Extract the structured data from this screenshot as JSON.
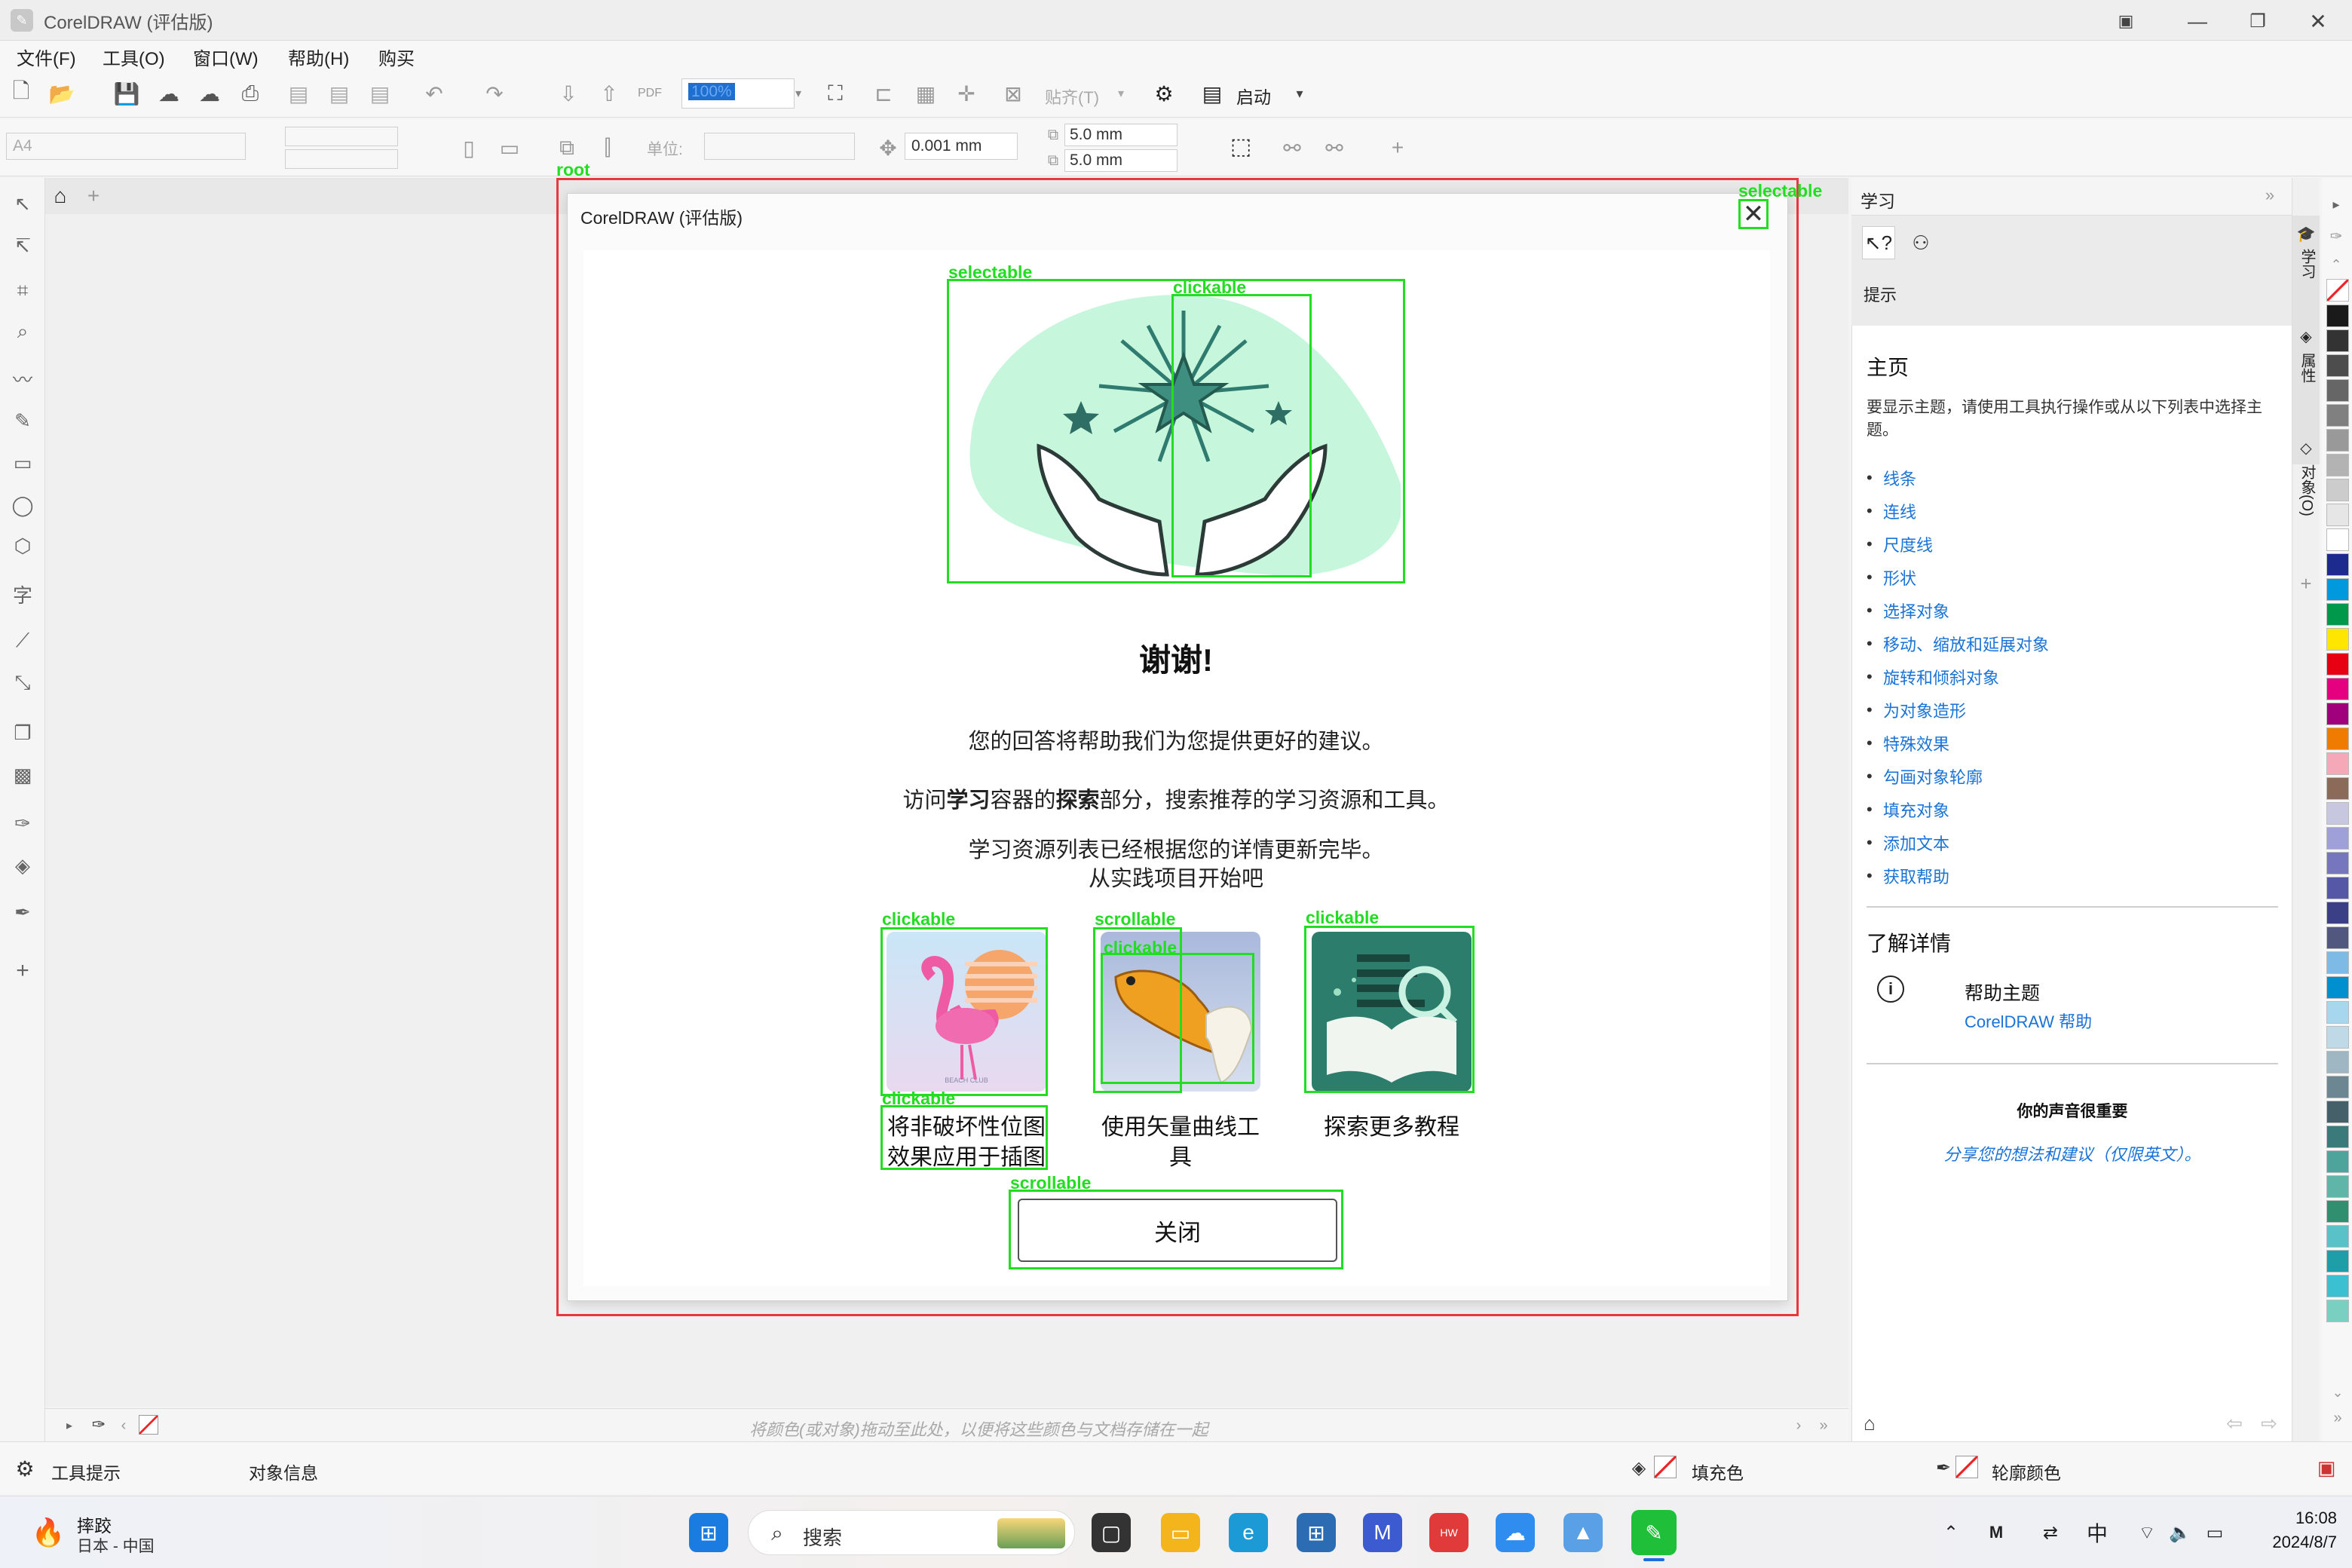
{
  "window": {
    "title": "CorelDRAW (评估版)"
  },
  "menu": [
    {
      "label": "文件(F)"
    },
    {
      "label": "工具(O)"
    },
    {
      "label": "窗口(W)"
    },
    {
      "label": "帮助(H)"
    },
    {
      "label": "购买"
    }
  ],
  "toolbar": {
    "zoom_value": "100%",
    "snap_label": "贴齐(T)",
    "launch_label": "启动"
  },
  "propertybar": {
    "page_size": "A4",
    "units_label": "单位:",
    "nudge": "0.001 mm",
    "dup_x": "5.0 mm",
    "dup_y": "5.0 mm"
  },
  "dialog": {
    "title": "CorelDRAW (评估版)",
    "heading": "谢谢!",
    "line1": "您的回答将帮助我们为您提供更好的建议。",
    "line2_pre": "访问",
    "line2_b1": "学习",
    "line2_mid": "容器的",
    "line2_b2": "探索",
    "line2_post": "部分，搜索推荐的学习资源和工具。",
    "line3": "学习资源列表已经根据您的详情更新完毕。",
    "line4": "从实践项目开始吧",
    "cards": [
      {
        "caption": "将非破坏性位图效果应用于插图",
        "icon": "flamingo-thumbnail"
      },
      {
        "caption": "使用矢量曲线工具",
        "icon": "goldfish-thumbnail"
      },
      {
        "caption": "探索更多教程",
        "icon": "book-search-thumbnail"
      }
    ],
    "close_label": "关闭",
    "flamingo_watermark": "BEACH CLUB"
  },
  "annotations": {
    "root": "root",
    "selectable": "selectable",
    "clickable": "clickable",
    "scrollable": "scrollable"
  },
  "learn_panel": {
    "title": "学习",
    "hints_label": "提示",
    "home_heading": "主页",
    "home_desc": "要显示主题，请使用工具执行操作或从以下列表中选择主题。",
    "topics": [
      "线条",
      "连线",
      "尺度线",
      "形状",
      "选择对象",
      "移动、缩放和延展对象",
      "旋转和倾斜对象",
      "为对象造形",
      "特殊效果",
      "勾画对象轮廓",
      "填充对象",
      "添加文本",
      "获取帮助"
    ],
    "more_heading": "了解详情",
    "help_title": "帮助主题",
    "help_link": "CorelDRAW 帮助",
    "voice_heading": "你的声音很重要",
    "voice_link": "分享您的想法和建议（仅限英文）。"
  },
  "side_tabs": [
    "学习",
    "属性",
    "对象(O)"
  ],
  "palette_colors": [
    "#ffffff",
    "#1a1a1a",
    "#333333",
    "#4d4d4d",
    "#666666",
    "#808080",
    "#999999",
    "#b3b3b3",
    "#cccccc",
    "#e6e6e6",
    "#ffffff",
    "#1d2a8e",
    "#0099dd",
    "#00994c",
    "#ffe600",
    "#e60012",
    "#e4007f",
    "#a1007d",
    "#ef7c00",
    "#f5a9b8",
    "#8c6a5a",
    "#c8c7e0",
    "#9fa0d8",
    "#7576be",
    "#5458a6",
    "#3b3f85",
    "#51577e",
    "#7dbbe6",
    "#0090d0",
    "#a7d7ee",
    "#bfd9e6",
    "#9fb7c2",
    "#6d8792",
    "#46606a",
    "#3b7a7a",
    "#4ea39b",
    "#5fb6a8",
    "#2f8f6f",
    "#59c1c8",
    "#1e9fa8",
    "#3ac0d0",
    "#7ad0c0"
  ],
  "colorbar_hint": "将颜色(或对象)拖动至此处，以便将这些颜色与文档存储在一起",
  "status": {
    "tooltips": "工具提示",
    "object_info": "对象信息",
    "fill_label": "填充色",
    "outline_label": "轮廓颜色"
  },
  "taskbar": {
    "weather_title": "摔跤",
    "weather_sub": "日本 - 中国",
    "search_placeholder": "搜索",
    "ime": "中",
    "time": "16:08",
    "date": "2024/8/7"
  }
}
